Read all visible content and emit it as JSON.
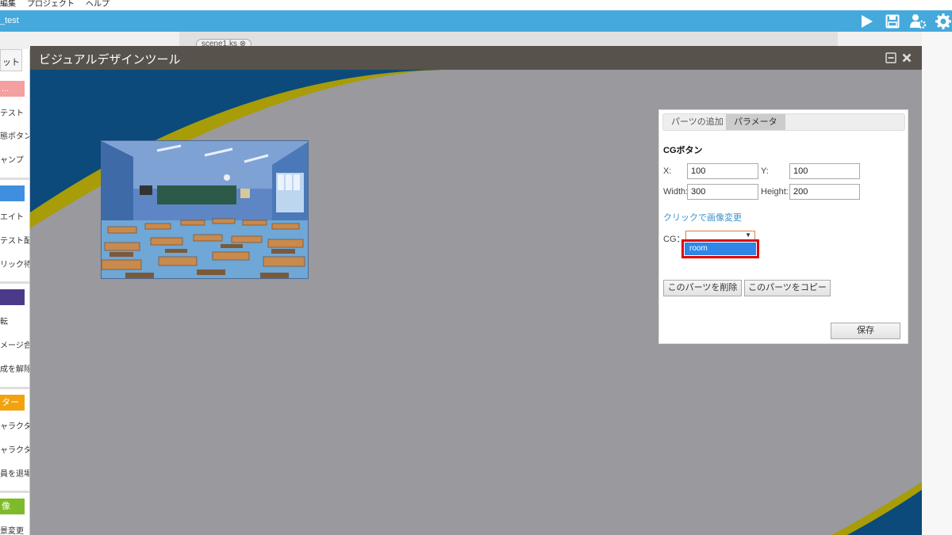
{
  "menu": {
    "items": [
      "編集",
      "プロジェクト",
      "ヘルプ"
    ]
  },
  "titlebar": {
    "project_name": "_test"
  },
  "editor": {
    "scene_tab": "scene1.ks ⊗"
  },
  "sidebar": {
    "tab_label": "ット",
    "categories": [
      {
        "label": "...",
        "color": "#f4a0a0"
      },
      {
        "label": "",
        "color": "#3f8fe0"
      },
      {
        "label": "",
        "color": "#4b3a8a"
      },
      {
        "label": "ター",
        "color": "#f2a20e"
      },
      {
        "label": "像",
        "color": "#7dbb2b"
      }
    ],
    "items": [
      "テスト",
      "態ボタン",
      "ャンプ",
      "エイト",
      "テスト配置",
      "リック待ち",
      "転",
      "メージ合成",
      "成を解除",
      "ャラクター",
      "ャラクター",
      "員を退場",
      "景変更"
    ]
  },
  "modal": {
    "title": "ビジュアルデザインツール",
    "panel": {
      "tabs": [
        "パーツの追加",
        "パラメータ"
      ],
      "active_tab": "パラメータ",
      "heading": "CGボタン",
      "x_label": "X:",
      "x_value": "100",
      "y_label": "Y:",
      "y_value": "100",
      "width_label": "Width:",
      "width_value": "300",
      "height_label": "Height:",
      "height_value": "200",
      "change_image_link": "クリックで画像変更",
      "cg_label": "CG：",
      "cg_select_arrow": "▼",
      "cg_option": "room",
      "delete_button": "このパーツを削除",
      "copy_button": "このパーツをコピー",
      "save_button": "保存"
    }
  },
  "colors": {
    "titlebar": "#45a9dc",
    "modal_header": "#57524b",
    "stage_gray": "#9a999d",
    "stage_navy": "#0b4a7a",
    "stage_olive": "#a89c08",
    "highlight_red": "#e00000",
    "option_blue": "#2f86e8"
  }
}
